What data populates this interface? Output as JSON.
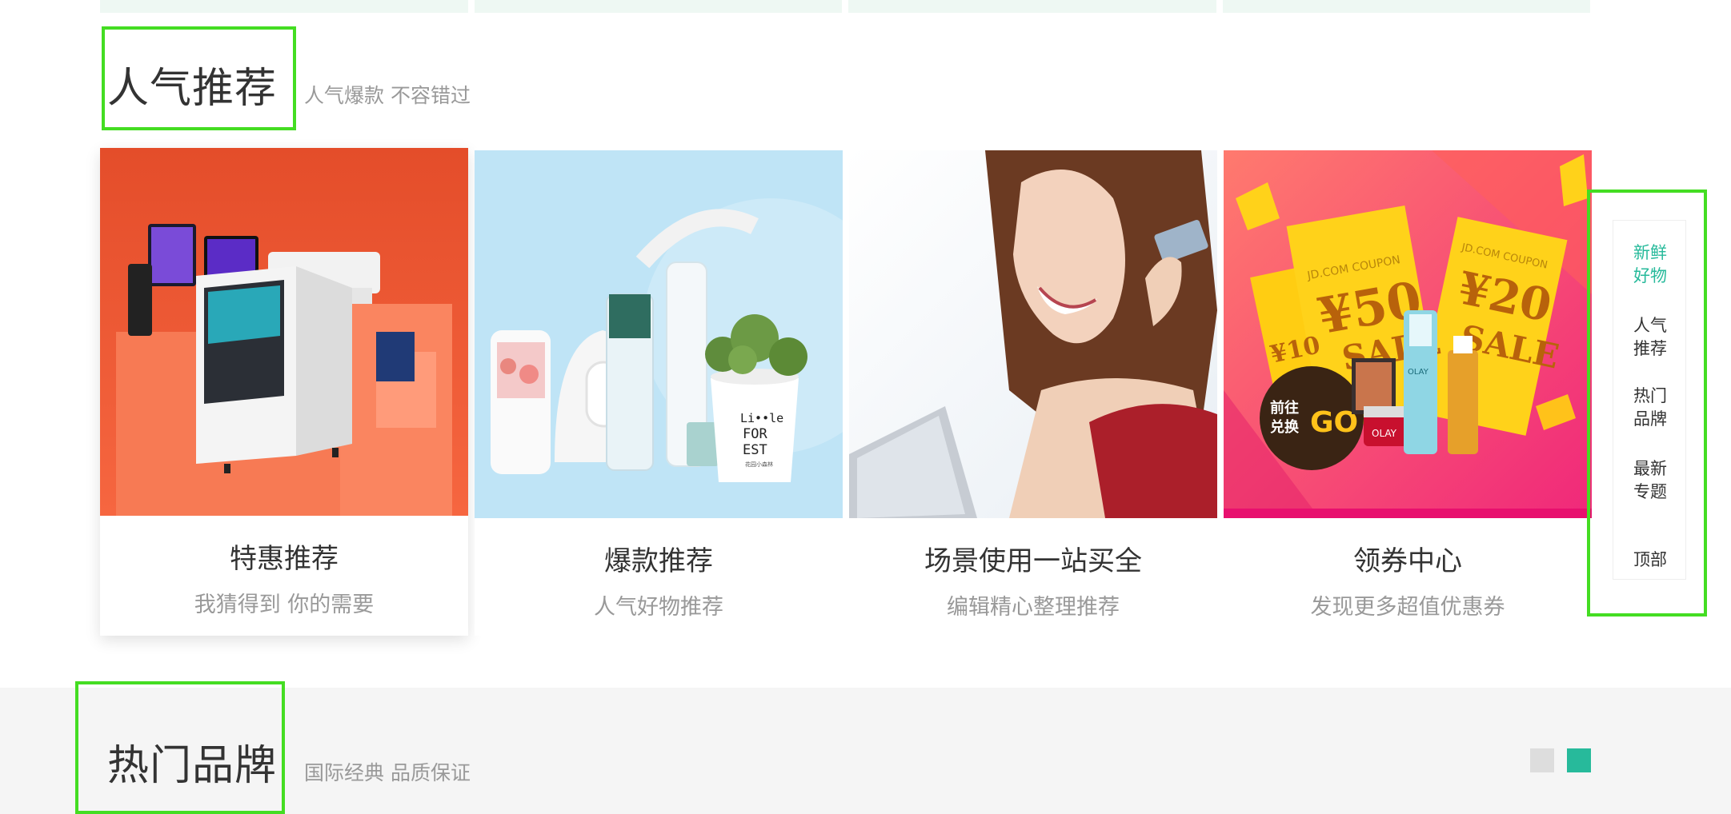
{
  "popular": {
    "title": "人气推荐",
    "subtitle": "人气爆款 不容错过",
    "cards": [
      {
        "title": "特惠推荐",
        "desc": "我猜得到 你的需要"
      },
      {
        "title": "爆款推荐",
        "desc": "人气好物推荐"
      },
      {
        "title": "场景使用一站买全",
        "desc": "编辑精心整理推荐"
      },
      {
        "title": "领券中心",
        "desc": "发现更多超值优惠券"
      }
    ]
  },
  "coupon_art": {
    "ticket_brand": "JD.COM COUPON",
    "values": [
      "¥10",
      "¥50",
      "¥20"
    ],
    "sale": "SALE",
    "go_badge_line1": "前往",
    "go_badge_line2": "兑换",
    "go_text": "GO",
    "product_brand": "OLAY"
  },
  "product_art": {
    "pot_text_line1": "Li••le",
    "pot_text_line2": "FOR",
    "pot_text_line3": "EST",
    "pot_subtext": "花园小森林"
  },
  "brands": {
    "title": "热门品牌",
    "subtitle": "国际经典 品质保证"
  },
  "elevator": {
    "items": [
      {
        "line1": "新鲜",
        "line2": "好物"
      },
      {
        "line1": "人气",
        "line2": "推荐"
      },
      {
        "line1": "热门",
        "line2": "品牌"
      },
      {
        "line1": "最新",
        "line2": "专题"
      },
      {
        "line1": "顶部",
        "line2": ""
      }
    ]
  },
  "colors": {
    "accent": "#27ba9b",
    "highlight": "#44dd22"
  }
}
